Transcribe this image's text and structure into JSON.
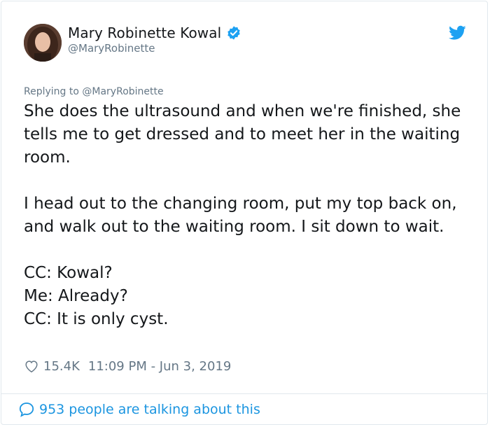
{
  "author": {
    "display_name": "Mary Robinette Kowal",
    "handle": "@MaryRobinette",
    "verified": true
  },
  "reply": {
    "prefix": "Replying to ",
    "mention": "@MaryRobinette"
  },
  "tweet": {
    "paragraphs": [
      "She does the ultrasound and when we're finished, she tells me to get dressed and to meet her in the waiting room.",
      "I head out to the changing room, put my top back on, and walk out to the waiting room. I sit down to wait."
    ],
    "dialogue": [
      "CC: Kowal?",
      "Me: Already?",
      "CC: It is only cyst."
    ]
  },
  "meta": {
    "likes": "15.4K",
    "timestamp": "11:09 PM - Jun 3, 2019"
  },
  "footer": {
    "talking": "953 people are talking about this"
  },
  "colors": {
    "brand_blue": "#1da1f2",
    "link_blue": "#1b95e0",
    "muted": "#657786",
    "text": "#14171a"
  },
  "icons": {
    "logo": "twitter-bird-icon",
    "verified": "verified-badge-icon",
    "like": "heart-icon",
    "reply": "speech-bubble-icon"
  }
}
